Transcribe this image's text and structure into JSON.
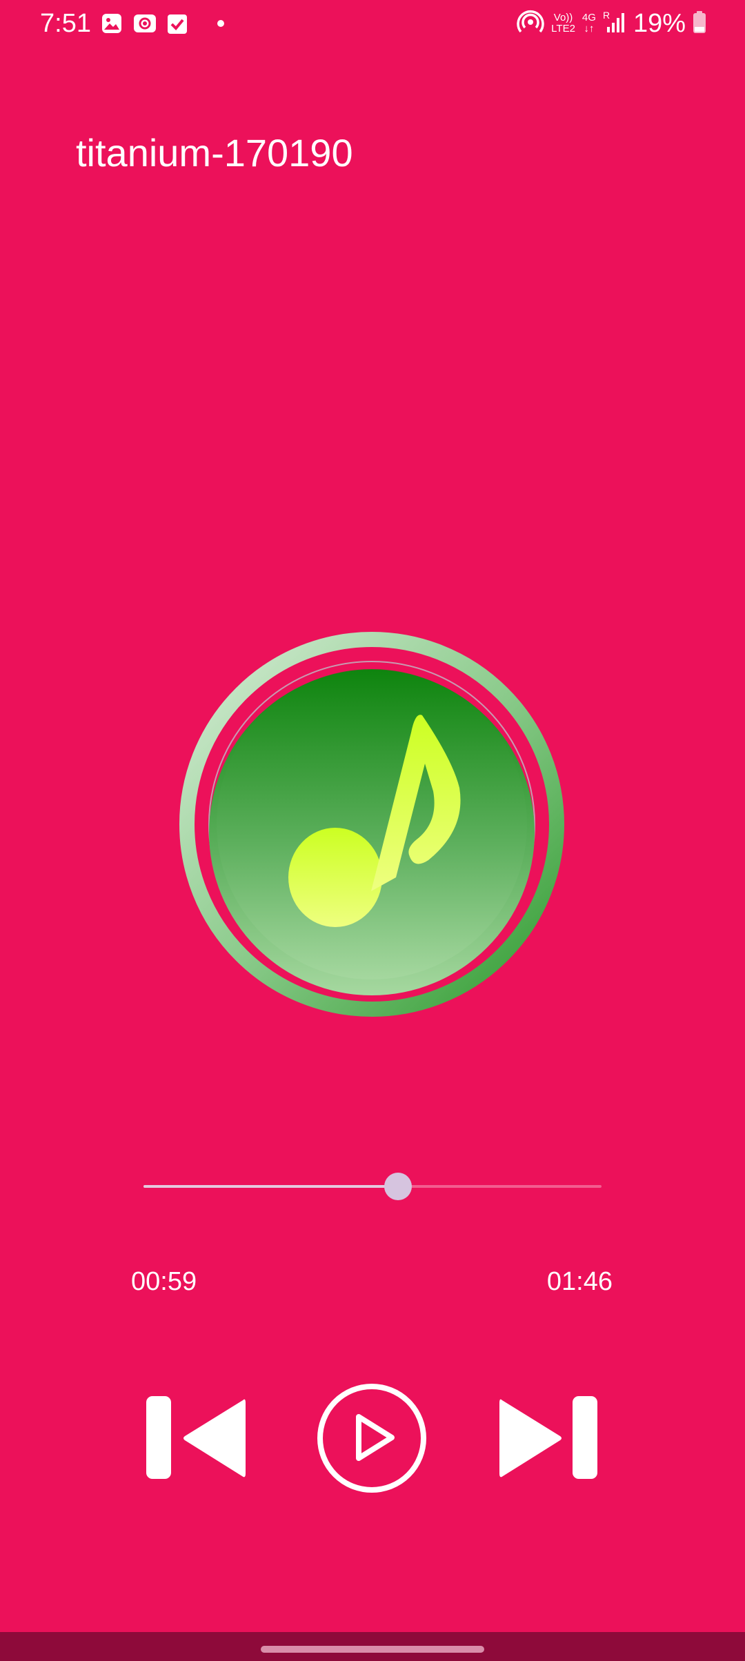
{
  "status_bar": {
    "time": "7:51",
    "left_icons": [
      "gallery-icon",
      "screen-record-icon",
      "checkbox-icon",
      "dot-icon"
    ],
    "right_icons": [
      "hotspot-icon",
      "volte-icon",
      "4g-data-icon",
      "signal-icon",
      "battery-icon"
    ],
    "volte_line1": "Vo))",
    "volte_line2": "LTE2",
    "network_label": "4G",
    "signal_label": "R",
    "battery_percent": "19%"
  },
  "player": {
    "track_title": "titanium-170190",
    "artwork_icon": "music-note-icon",
    "progress": {
      "current_time": "00:59",
      "total_time": "01:46",
      "fraction": 0.556
    },
    "controls": {
      "previous_icon": "skip-previous-icon",
      "play_icon": "play-icon",
      "next_icon": "skip-next-icon"
    }
  },
  "colors": {
    "background": "#EC115A",
    "nav_bar": "#8E0A3A",
    "seek_fill": "#E4C9DE",
    "seek_thumb": "#D6C4DF",
    "artwork_green": "#1F8F1F",
    "note_yellow": "#E4FF5C"
  }
}
